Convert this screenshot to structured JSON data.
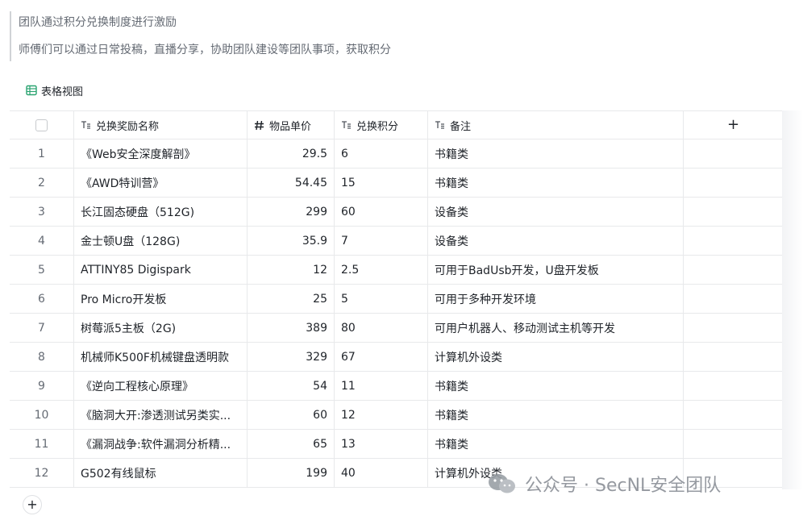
{
  "intro": {
    "line1": "团队通过积分兑换制度进行激励",
    "line2": "师傅们可以通过日常投稿，直播分享，协助团队建设等团队事项，获取积分"
  },
  "view": {
    "label": "表格视图",
    "icon": "table-view-icon"
  },
  "table": {
    "columns": [
      {
        "label": "兑换奖励名称",
        "icon": "text-field-icon"
      },
      {
        "label": "物品单价",
        "icon": "number-field-icon"
      },
      {
        "label": "兑换积分",
        "icon": "text-field-icon"
      },
      {
        "label": "备注",
        "icon": "text-field-icon"
      }
    ],
    "add_column": "+",
    "rows": [
      {
        "idx": "1",
        "name": "《Web安全深度解剖》",
        "price": "29.5",
        "points": "6",
        "note": "书籍类"
      },
      {
        "idx": "2",
        "name": "《AWD特训营》",
        "price": "54.45",
        "points": "15",
        "note": "书籍类"
      },
      {
        "idx": "3",
        "name": "长江固态硬盘（512G)",
        "price": "299",
        "points": "60",
        "note": "设备类"
      },
      {
        "idx": "4",
        "name": "金士顿U盘（128G)",
        "price": "35.9",
        "points": "7",
        "note": "设备类"
      },
      {
        "idx": "5",
        "name": "ATTINY85 Digispark",
        "price": "12",
        "points": "2.5",
        "note": "可用于BadUsb开发，U盘开发板"
      },
      {
        "idx": "6",
        "name": "Pro Micro开发板",
        "price": "25",
        "points": "5",
        "note": "可用于多种开发环境"
      },
      {
        "idx": "7",
        "name": "树莓派5主板（2G)",
        "price": "389",
        "points": "80",
        "note": "可用户机器人、移动测试主机等开发"
      },
      {
        "idx": "8",
        "name": "机械师K500F机械键盘透明款",
        "price": "329",
        "points": "67",
        "note": "计算机外设类"
      },
      {
        "idx": "9",
        "name": "《逆向工程核心原理》",
        "price": "54",
        "points": "11",
        "note": "书籍类"
      },
      {
        "idx": "10",
        "name": "《脑洞大开:渗透测试另类实...",
        "price": "60",
        "points": "12",
        "note": "书籍类"
      },
      {
        "idx": "11",
        "name": "《漏洞战争:软件漏洞分析精...",
        "price": "65",
        "points": "13",
        "note": "书籍类"
      },
      {
        "idx": "12",
        "name": "G502有线鼠标",
        "price": "199",
        "points": "40",
        "note": "计算机外设类"
      }
    ],
    "add_row": "+"
  },
  "watermark": {
    "text": "公众号 · SecNL安全团队",
    "icon": "wechat-icon"
  },
  "colors": {
    "accent_green": "#2ba471",
    "border": "#e8e9eb",
    "muted_text": "#646a73"
  }
}
